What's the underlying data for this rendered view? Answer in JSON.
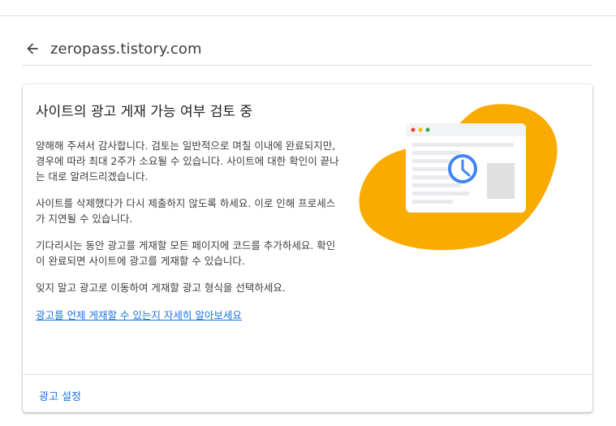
{
  "header": {
    "site": "zeropass.tistory.com",
    "back_icon": "arrow-back-icon"
  },
  "card": {
    "title": "사이트의 광고 게재 가능 여부 검토 중",
    "paragraphs": [
      "양해해 주셔서 감사합니다. 검토는 일반적으로 며칠 이내에 완료되지만, 경우에 따라 최대 2주가 소요될 수 있습니다. 사이트에 대한 확인이 끝나는 대로 알려드리겠습니다.",
      "사이트를 삭제했다가 다시 제출하지 않도록 하세요. 이로 인해 프로세스가 지연될 수 있습니다.",
      "기다리시는 동안 광고를 게재할 모든 페이지에 코드를 추가하세요. 확인이 완료되면 사이트에 광고를 게재할 수 있습니다.",
      "잊지 말고 광고로 이동하여 게재할 광고 형식을 선택하세요."
    ],
    "learn_more_link": "광고를 언제 게재할 수 있는지 자세히 알아보세요",
    "ad_settings_label": "광고 설정",
    "illustration_icon": "clock-icon"
  },
  "colors": {
    "blob": "#f9ab00",
    "link": "#1a73e8",
    "clock": "#4285f4",
    "dot_red": "#ea4335",
    "dot_yellow": "#fbbc04",
    "dot_green": "#34a853"
  }
}
